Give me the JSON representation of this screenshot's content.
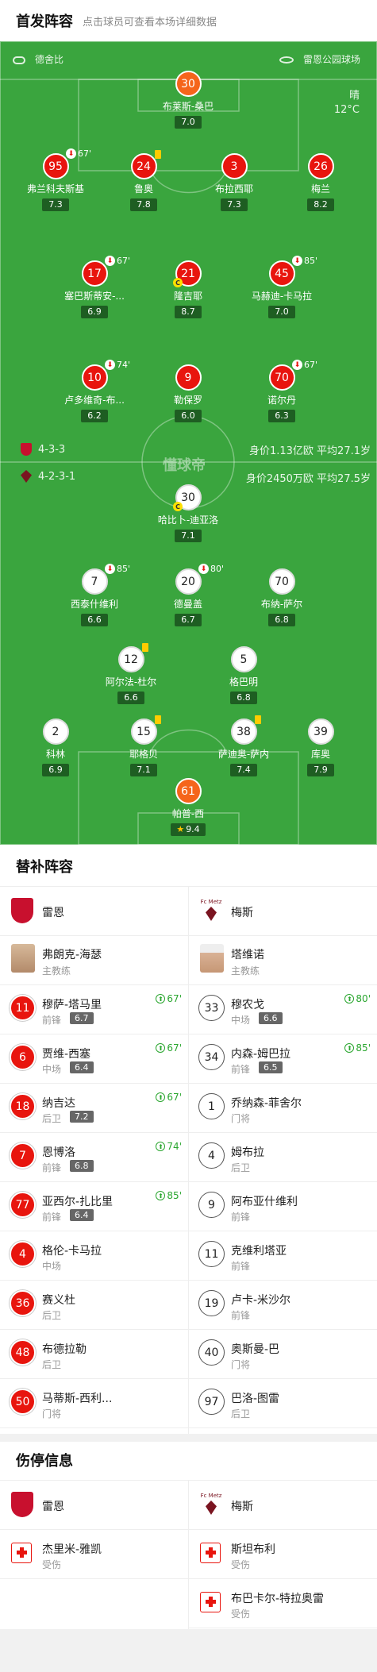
{
  "header": {
    "title": "首发阵容",
    "subtitle": "点击球员可查看本场详细数据"
  },
  "pitch": {
    "home_team": "德舍比",
    "away_team": "雷恩公园球场",
    "weather": "晴",
    "temperature": "12°C",
    "watermark": "懂球帝",
    "home_formation": "4-3-3",
    "home_value": "身价1.13亿欧",
    "home_avg_age": "平均27.1岁",
    "away_formation": "4-2-3-1",
    "away_value": "身价2450万欧",
    "away_avg_age": "平均27.5岁"
  },
  "players": [
    {
      "num": "30",
      "name": "布莱斯-桑巴",
      "rating": "7.0",
      "style": "orange"
    },
    {
      "num": "95",
      "name": "弗兰科夫斯基",
      "rating": "7.3",
      "style": "red",
      "sub": "67'"
    },
    {
      "num": "24",
      "name": "鲁奥",
      "rating": "7.8",
      "style": "red",
      "card": true
    },
    {
      "num": "3",
      "name": "布拉西耶",
      "rating": "7.3",
      "style": "red"
    },
    {
      "num": "26",
      "name": "梅兰",
      "rating": "8.2",
      "style": "red"
    },
    {
      "num": "17",
      "name": "塞巴斯蒂安-...",
      "rating": "6.9",
      "style": "red",
      "sub": "67'"
    },
    {
      "num": "21",
      "name": "隆吉耶",
      "rating": "8.7",
      "style": "red",
      "captain": true
    },
    {
      "num": "45",
      "name": "马赫迪-卡马拉",
      "rating": "7.0",
      "style": "red",
      "sub": "85'"
    },
    {
      "num": "10",
      "name": "卢多维奇-布...",
      "rating": "6.2",
      "style": "red",
      "sub": "74'"
    },
    {
      "num": "9",
      "name": "勒保罗",
      "rating": "6.0",
      "style": "red"
    },
    {
      "num": "70",
      "name": "诺尔丹",
      "rating": "6.3",
      "style": "red",
      "sub": "67'"
    },
    {
      "num": "30",
      "name": "哈比卜-迪亚洛",
      "rating": "7.1",
      "style": "white",
      "captain": true
    },
    {
      "num": "7",
      "name": "西泰什维利",
      "rating": "6.6",
      "style": "white",
      "sub": "85'"
    },
    {
      "num": "20",
      "name": "德曼盖",
      "rating": "6.7",
      "style": "white",
      "sub": "80'"
    },
    {
      "num": "70",
      "name": "布纳-萨尔",
      "rating": "6.8",
      "style": "white"
    },
    {
      "num": "12",
      "name": "阿尔法-杜尔",
      "rating": "6.6",
      "style": "white",
      "card": true
    },
    {
      "num": "5",
      "name": "格巴明",
      "rating": "6.8",
      "style": "white"
    },
    {
      "num": "2",
      "name": "科林",
      "rating": "6.9",
      "style": "white"
    },
    {
      "num": "15",
      "name": "耶格贝",
      "rating": "7.1",
      "style": "white",
      "card": true
    },
    {
      "num": "38",
      "name": "萨迪奥-萨内",
      "rating": "7.4",
      "style": "white",
      "card": true
    },
    {
      "num": "39",
      "name": "库奥",
      "rating": "7.9",
      "style": "white"
    },
    {
      "num": "61",
      "name": "帕普-西",
      "rating": "9.4",
      "style": "orange",
      "star": true
    }
  ],
  "subs": {
    "title": "替补阵容",
    "home_team": "雷恩",
    "away_team": "梅斯",
    "home_coach": "弗朗克-海瑟",
    "away_coach": "塔维诺",
    "coach_label": "主教练",
    "home": [
      {
        "num": "11",
        "name": "穆萨-塔马里",
        "pos": "前锋",
        "rating": "6.7",
        "min": "67'"
      },
      {
        "num": "6",
        "name": "贾维-西塞",
        "pos": "中场",
        "rating": "6.4",
        "min": "67'"
      },
      {
        "num": "18",
        "name": "纳吉达",
        "pos": "后卫",
        "rating": "7.2",
        "min": "67'"
      },
      {
        "num": "7",
        "name": "恩博洛",
        "pos": "前锋",
        "rating": "6.8",
        "min": "74'"
      },
      {
        "num": "77",
        "name": "亚西尔-扎比里",
        "pos": "前锋",
        "rating": "6.4",
        "min": "85'"
      },
      {
        "num": "4",
        "name": "格伦-卡马拉",
        "pos": "中场"
      },
      {
        "num": "36",
        "name": "赛义杜",
        "pos": "后卫"
      },
      {
        "num": "48",
        "name": "布德拉勒",
        "pos": "后卫"
      },
      {
        "num": "50",
        "name": "马蒂斯-西利...",
        "pos": "门将"
      }
    ],
    "away": [
      {
        "num": "33",
        "name": "穆农戈",
        "pos": "中场",
        "rating": "6.6",
        "min": "80'"
      },
      {
        "num": "34",
        "name": "内森-姆巴拉",
        "pos": "前锋",
        "rating": "6.5",
        "min": "85'"
      },
      {
        "num": "1",
        "name": "乔纳森-菲舍尔",
        "pos": "门将"
      },
      {
        "num": "4",
        "name": "姆布拉",
        "pos": "后卫"
      },
      {
        "num": "9",
        "name": "阿布亚什维利",
        "pos": "前锋"
      },
      {
        "num": "11",
        "name": "克维利塔亚",
        "pos": "前锋"
      },
      {
        "num": "19",
        "name": "卢卡-米沙尔",
        "pos": "前锋"
      },
      {
        "num": "40",
        "name": "奥斯曼-巴",
        "pos": "门将"
      },
      {
        "num": "97",
        "name": "巴洛-图雷",
        "pos": "后卫"
      }
    ]
  },
  "injuries": {
    "title": "伤停信息",
    "home_team": "雷恩",
    "away_team": "梅斯",
    "home": [
      {
        "name": "杰里米-雅凯",
        "status": "受伤"
      }
    ],
    "away": [
      {
        "name": "斯坦布利",
        "status": "受伤"
      },
      {
        "name": "布巴卡尔-特拉奥雷",
        "status": "受伤"
      }
    ]
  },
  "logo_text": {
    "away": "Fc Metz"
  }
}
